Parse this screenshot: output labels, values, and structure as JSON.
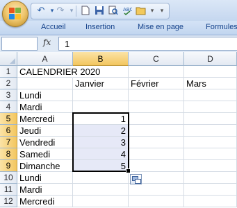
{
  "quick_access": {
    "icons": [
      "undo-icon",
      "redo-icon",
      "new-document-icon",
      "save-icon",
      "print-preview-icon",
      "spelling-icon",
      "open-icon",
      "customize-icon"
    ]
  },
  "ribbon": {
    "tabs": [
      "Accueil",
      "Insertion",
      "Mise en page",
      "Formules"
    ]
  },
  "formula_bar": {
    "fx_label": "fx",
    "value": "1"
  },
  "sheet": {
    "columns": [
      "A",
      "B",
      "C",
      "D"
    ],
    "rows": [
      "1",
      "2",
      "3",
      "4",
      "5",
      "6",
      "7",
      "8",
      "9",
      "10",
      "11",
      "12"
    ],
    "cells": {
      "A1": "CALENDRIER 2020",
      "B2": "Janvier",
      "C2": "Février",
      "D2": "Mars",
      "A3": "Lundi",
      "A4": "Mardi",
      "A5": "Mercredi",
      "A6": "Jeudi",
      "A7": "Vendredi",
      "A8": "Samedi",
      "A9": "Dimanche",
      "A10": "Lundi",
      "A11": "Mardi",
      "A12": "Mercredi",
      "B5": "1",
      "B6": "2",
      "B7": "3",
      "B8": "4",
      "B9": "5"
    },
    "selected_range": "B5:B9",
    "selection_colors": {
      "highlight": "#e6e9f7",
      "header_highlight": "#f3c65f"
    }
  }
}
